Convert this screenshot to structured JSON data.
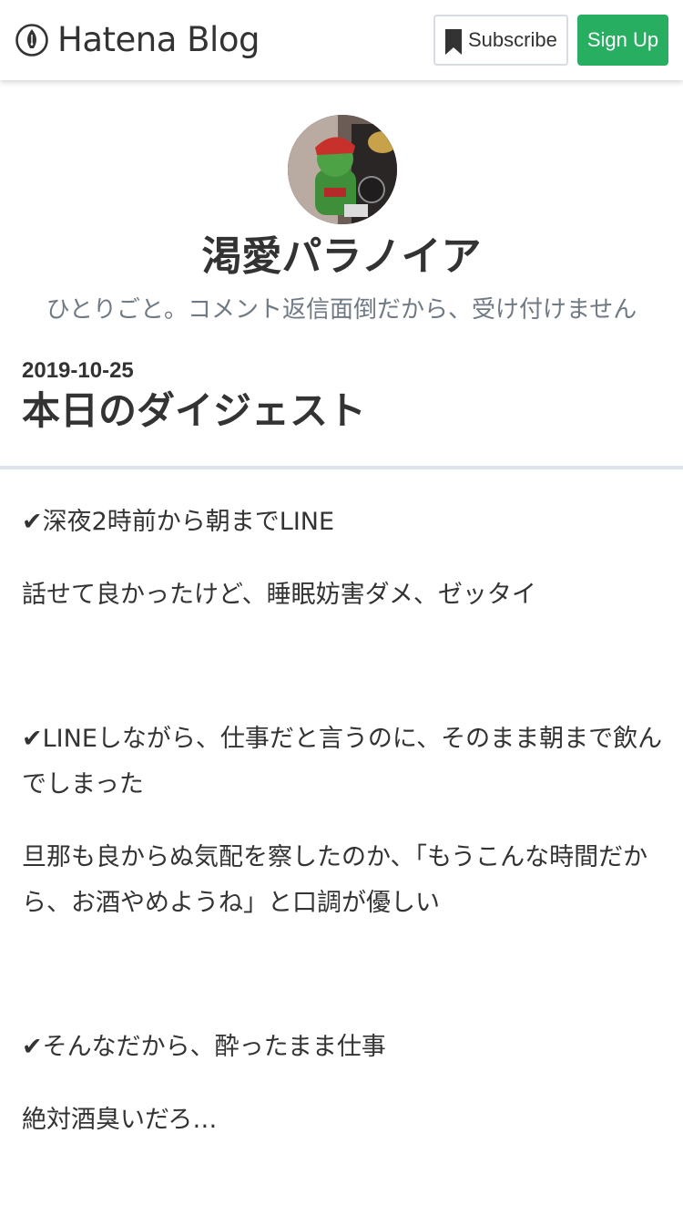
{
  "header": {
    "logo_text": "Hatena Blog",
    "subscribe_label": "Subscribe",
    "signup_label": "Sign Up",
    "logo_icon": "hatena-pen-icon",
    "bookmark_icon": "bookmark-icon",
    "colors": {
      "signup_bg": "#27ae60",
      "text": "#333333"
    }
  },
  "blog": {
    "title": "渇愛パラノイア",
    "description": "ひとりごと。コメント返信面倒だから、受け付けません"
  },
  "entry": {
    "date": "2019-10-25",
    "title": "本日のダイジェスト",
    "paragraphs": [
      "✔深夜2時前から朝までLINE",
      "話せて良かったけど、睡眠妨害ダメ、ゼッタイ",
      "✔LINEしながら、仕事だと言うのに、そのまま朝まで飲んでしまった",
      "旦那も良からぬ気配を察したのか、「もうこんな時間だから、お酒やめようね」と口調が優しい",
      "✔そんなだから、酔ったまま仕事",
      "絶対酒臭いだろ…"
    ]
  }
}
